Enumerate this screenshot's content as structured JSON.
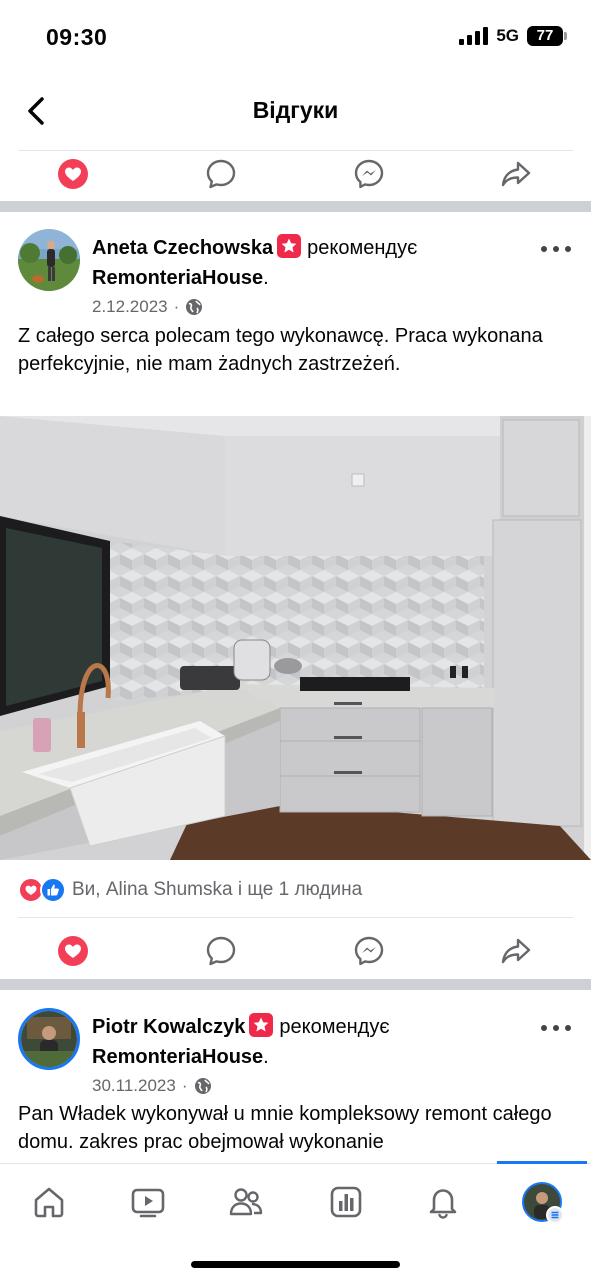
{
  "status": {
    "time": "09:30",
    "network": "5G",
    "battery": "77"
  },
  "nav": {
    "title": "Відгуки",
    "back_icon": "chevron-left-icon"
  },
  "actions": {
    "icons": [
      "love-icon",
      "comment-icon",
      "messenger-icon",
      "share-icon"
    ]
  },
  "posts": [
    {
      "author": "Aneta Czechowska",
      "recommends": "рекомендує",
      "page": "RemonteriaHouse",
      "date": "2.12.2023",
      "audience_icon": "globe-icon",
      "text": "Z całego serca polecam tego wykonawcę. Praca wykonana perfekcyjnie, nie mam żadnych zastrzeżeń.",
      "reactions_text": "Ви, Alina Shumska і ще 1 людина"
    },
    {
      "author": "Piotr Kowalczyk",
      "recommends": "рекомендує",
      "page": "RemonteriaHouse",
      "date": "30.11.2023",
      "audience_icon": "globe-icon",
      "text": "Pan Władek wykonywał u mnie kompleksowy remont całego domu. zakres prac obejmował wykonanie"
    }
  ],
  "tabbar": {
    "icons": [
      "home-icon",
      "video-icon",
      "friends-icon",
      "dashboard-icon",
      "notifications-icon",
      "profile-menu-icon"
    ]
  },
  "colors": {
    "love": "#f33e58",
    "like": "#1877f2",
    "recommend_badge": "#f02849",
    "separator": "#cdd0d5"
  }
}
